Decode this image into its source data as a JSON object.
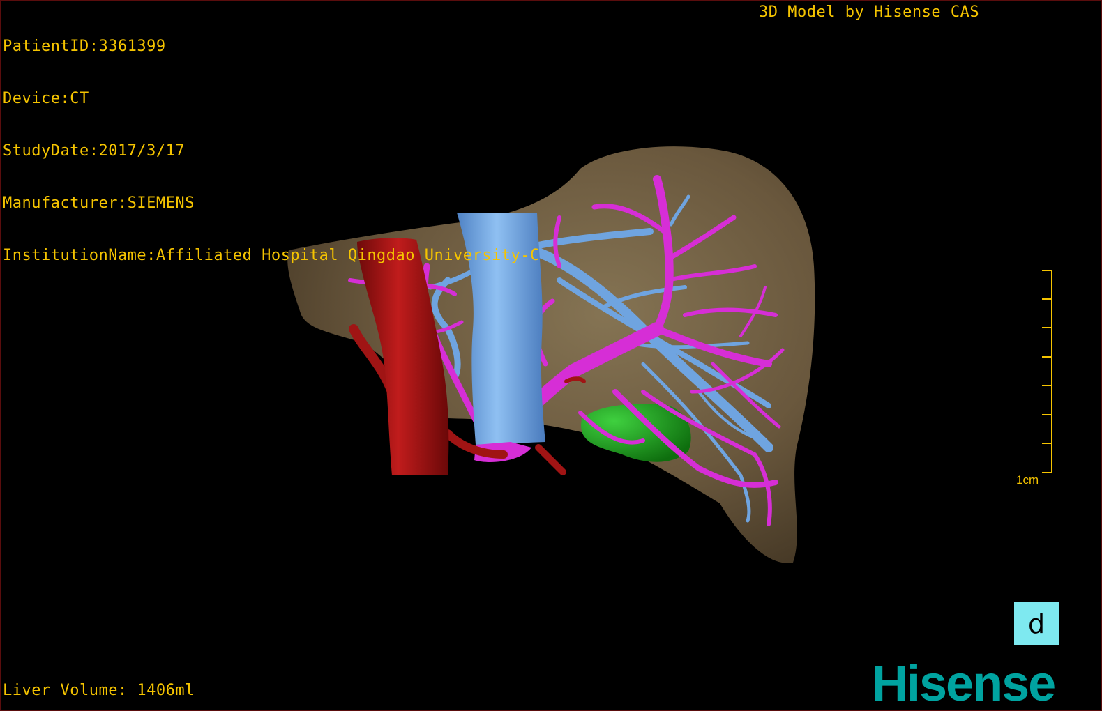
{
  "dicom": {
    "patient_id": "PatientID:3361399",
    "device": "Device:CT",
    "study_date": "StudyDate:2017/3/17",
    "manufacturer": "Manufacturer:SIEMENS",
    "institution": "InstitutionName:Affiliated Hospital Qingdao University-C"
  },
  "credit": "3D Model by Hisense CAS",
  "liver_volume": "Liver Volume: 1406ml",
  "scale_bar": {
    "label": "1cm"
  },
  "view_button": {
    "label": "d"
  },
  "brand": {
    "logo": "Hisense"
  },
  "colors": {
    "overlay_text": "#f5c400",
    "liver": "#7a6648",
    "hepatic_artery": "#b31515",
    "vena_cava": "#6fa4e0",
    "portal_vein": "#d62ed6",
    "gallbladder": "#1fa81f",
    "view_button": "#7ee9f0",
    "brand": "#00a3a0"
  }
}
